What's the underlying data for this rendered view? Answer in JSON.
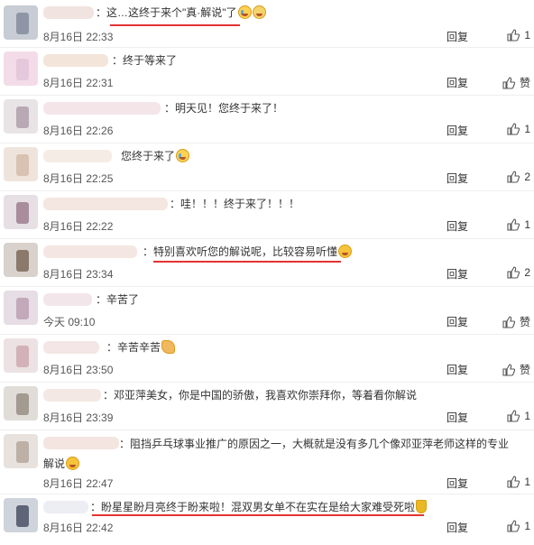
{
  "comments": [
    {
      "text": "：这…这终于来个\"真·解说\"了",
      "emoji": [
        "crying-face",
        "screaming-face"
      ],
      "time": "8月16日 22:33",
      "reply": "回复",
      "likes": "1"
    },
    {
      "text": "：终于等来了",
      "emoji": [],
      "time": "8月16日 22:31",
      "reply": "回复",
      "likes": "赞"
    },
    {
      "text": "：明天见！您终于来了！",
      "emoji": [],
      "time": "8月16日 22:26",
      "reply": "回复",
      "likes": "1"
    },
    {
      "text": "您终于来了",
      "emoji": [
        "crying-face"
      ],
      "time": "8月16日 22:25",
      "reply": "回复",
      "likes": "2"
    },
    {
      "text": "：哇！！！终于来了！！！",
      "emoji": [],
      "time": "8月16日 22:22",
      "reply": "回复",
      "likes": "1"
    },
    {
      "text": "：特别喜欢听您的解说呢，比较容易听懂",
      "emoji": [
        "laughing-face"
      ],
      "time": "8月16日 23:34",
      "reply": "回复",
      "likes": "2"
    },
    {
      "text": "：辛苦了",
      "emoji": [],
      "time": "今天 09:10",
      "reply": "回复",
      "likes": "赞"
    },
    {
      "text": "：辛苦辛苦",
      "emoji": [
        "muscle"
      ],
      "time": "8月16日 23:50",
      "reply": "回复",
      "likes": "赞"
    },
    {
      "text": "：邓亚萍美女，你是中国的骄傲，我喜欢你崇拜你，等着看你解说",
      "emoji": [],
      "time": "8月16日 23:39",
      "reply": "回复",
      "likes": "1"
    },
    {
      "text": "：阻挡乒乓球事业推广的原因之一，大概就是没有多几个像邓亚萍老师这样的专业解说",
      "emoji": [
        "laughing-face"
      ],
      "time": "8月16日 22:47",
      "reply": "回复",
      "likes": "1"
    },
    {
      "text": "：盼星星盼月亮终于盼来啦！混双男女单不在实在是给大家难受死啦",
      "emoji": [
        "trophy"
      ],
      "time": "8月16日 22:42",
      "reply": "回复",
      "likes": "1"
    }
  ]
}
